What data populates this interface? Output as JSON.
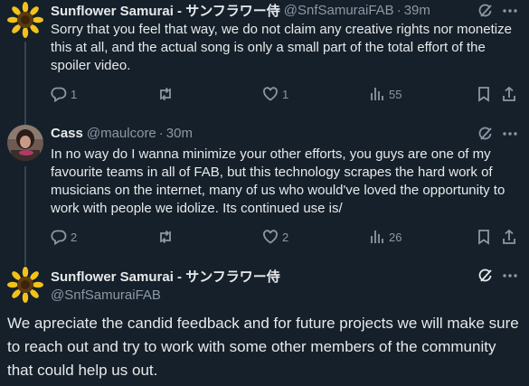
{
  "tweets": [
    {
      "name": "Sunflower Samurai - サンフラワー侍",
      "handle": "@SnfSamuraiFAB",
      "time": "39m",
      "text": "Sorry that you feel that way, we do not claim any creative rights nor monetize this at all, and the actual song is only a small part of the total effort of the spoiler video.",
      "replies": "1",
      "likes": "1",
      "views": "55"
    },
    {
      "name": "Cass",
      "handle": "@maulcore",
      "time": "30m",
      "text": "In no way do I wanna minimize your other efforts, you guys are one of my favourite teams in all of FAB, but this technology scrapes the hard work of musicians on the internet, many of us who would've loved the opportunity to work with people we idolize. Its continued use is/",
      "replies": "2",
      "likes": "2",
      "views": "26"
    }
  ],
  "main_tweet": {
    "name": "Sunflower Samurai - サンフラワー侍",
    "handle": "@SnfSamuraiFAB",
    "text": "We apreciate the candid feedback and for future projects we will make sure to reach out and try to work with some other members of the community that could help us out."
  },
  "colors": {
    "background": "#15202b",
    "text": "#e7e9ea",
    "muted": "#8b98a5",
    "divider": "#38444d"
  },
  "icons": [
    "sunflower-avatar",
    "grok-icon",
    "more-icon",
    "reply-icon",
    "retweet-icon",
    "like-icon",
    "views-icon",
    "bookmark-icon",
    "share-icon"
  ]
}
